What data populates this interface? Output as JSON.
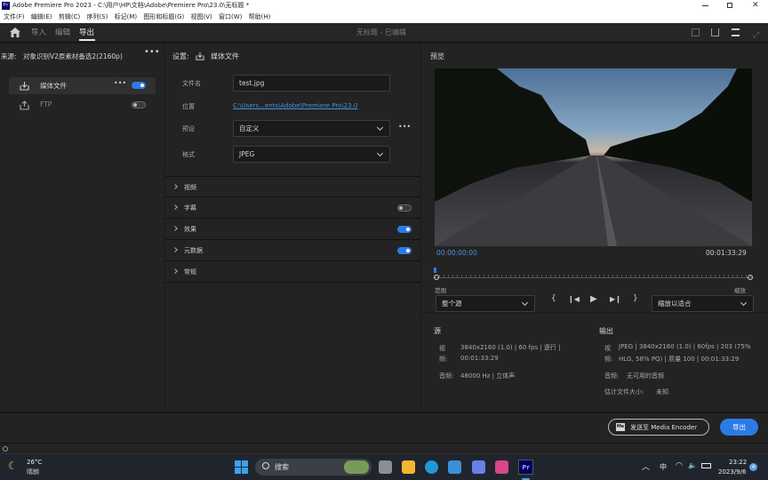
{
  "window": {
    "title": "Adobe Premiere Pro 2023 - C:\\用户\\HP\\文档\\Adobe\\Premiere Pro\\23.0\\无标题 *",
    "app_icon": "Pr"
  },
  "menu": [
    "文件(F)",
    "编辑(E)",
    "剪辑(C)",
    "序列(S)",
    "标记(M)",
    "图形和标题(G)",
    "视图(V)",
    "窗口(W)",
    "帮助(H)"
  ],
  "modes": {
    "import": "导入",
    "edit": "编辑",
    "export": "导出",
    "project_title": "无标题 - 已编辑"
  },
  "source": {
    "label": "来源:",
    "name": "对象识别V2原素材备选2(2160p)"
  },
  "destinations": [
    {
      "label": "媒体文件",
      "enabled": true
    },
    {
      "label": "FTP",
      "enabled": false
    }
  ],
  "settings": {
    "header_label": "设置:",
    "header_target": "媒体文件",
    "filename_label": "文件名",
    "filename_value": "test.jpg",
    "location_label": "位置",
    "location_value": "C:\\Users...ents\\Adobe\\Premiere Pro\\23.0",
    "preset_label": "预设",
    "preset_value": "自定义",
    "format_label": "格式",
    "format_value": "JPEG"
  },
  "sections": [
    {
      "label": "视频",
      "toggle": null
    },
    {
      "label": "字幕",
      "toggle": false
    },
    {
      "label": "效果",
      "toggle": true
    },
    {
      "label": "元数据",
      "toggle": true
    },
    {
      "label": "常规",
      "toggle": null
    }
  ],
  "preview": {
    "title": "预览",
    "timecode_start": "00:00:00:00",
    "timecode_end": "00:01:33:29",
    "range_label": "范围",
    "range_value": "整个源",
    "scale_label": "缩放",
    "scale_value": "缩放以适合"
  },
  "source_info": {
    "title": "源",
    "video_label": "视频:",
    "video_line1": "3840x2160 (1.0) | 60 fps | 逐行 |",
    "video_line2": "00:01:33:29",
    "audio_label": "音频:",
    "audio_value": "48000 Hz | 立体声"
  },
  "output_info": {
    "title": "输出",
    "video_label": "视频:",
    "video_line1": "JPEG | 3840x2160 (1.0) | 60fps | 203 (75%",
    "video_line2": "HLG, 58% PQ) | 质量 100 | 00:01:33:29",
    "audio_label": "音频:",
    "audio_value": "无可用的音频",
    "size_label": "估计文件大小:",
    "size_value": "未知"
  },
  "footer": {
    "encoder_button": "发送至 Media Encoder",
    "encoder_icon": "Me",
    "export_button": "导出"
  },
  "taskbar": {
    "temperature": "26°C",
    "weather": "晴朗",
    "search_placeholder": "搜索",
    "ime": "中",
    "time": "23:22",
    "date": "2023/9/6",
    "notification_count": "4",
    "pr_icon": "Pr"
  },
  "colors": {
    "accent": "#2c7be5",
    "link": "#4a8fe0",
    "timecode": "#4d8fe6"
  }
}
